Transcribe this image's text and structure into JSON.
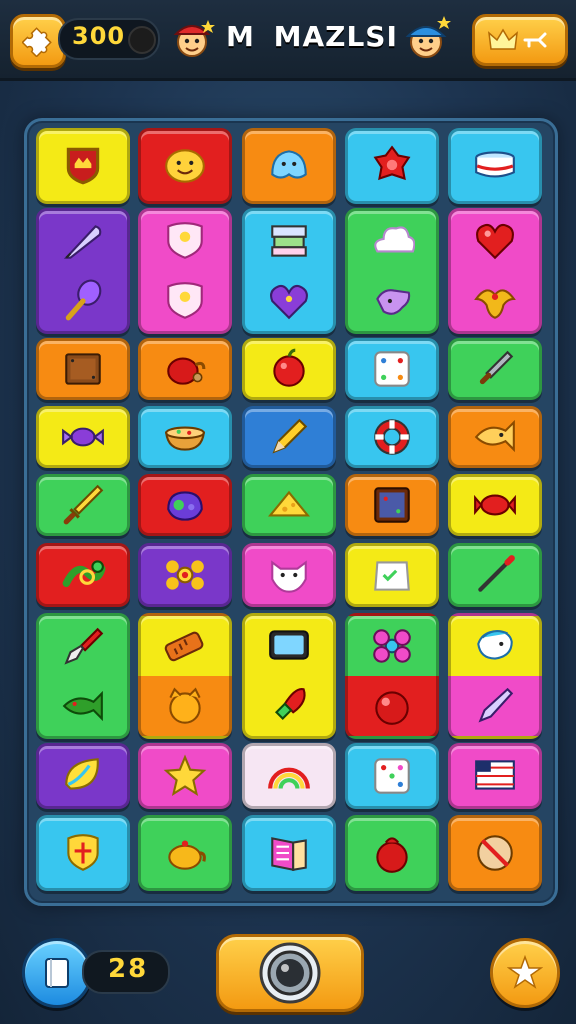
{
  "header": {
    "coins": "300",
    "title": "M MAZLSI",
    "title_prefix": "M",
    "title_main": "MAZLSI"
  },
  "footer": {
    "counter": "28"
  },
  "colors": {
    "yellow": "#f4ea16",
    "red": "#e21f1f",
    "orange": "#f78b12",
    "sky": "#38c6ef",
    "purple": "#7a37c9",
    "pink": "#f04bc8",
    "green": "#3fd15a",
    "blue": "#2f7fd6",
    "white_pink": "#f6e6f3"
  },
  "board": {
    "tiles": [
      {
        "row": 0,
        "col": 0,
        "bg": "yellow",
        "icon": "shield-crown-icon"
      },
      {
        "row": 0,
        "col": 1,
        "bg": "red",
        "icon": "smiley-blob-icon"
      },
      {
        "row": 0,
        "col": 2,
        "bg": "orange",
        "icon": "blue-slime-icon"
      },
      {
        "row": 0,
        "col": 3,
        "bg": "sky",
        "icon": "red-gem-flower-icon"
      },
      {
        "row": 0,
        "col": 4,
        "bg": "sky",
        "icon": "striped-bowl-icon"
      },
      {
        "row": 1,
        "col": 0,
        "bg": "purple",
        "icon": "feather-pen-icon",
        "icon2": "purple-torch-icon",
        "tall": true
      },
      {
        "row": 1,
        "col": 1,
        "bg": "pink",
        "icon": "pink-shield-icon",
        "icon2": "pink-shield-icon",
        "tall": true
      },
      {
        "row": 1,
        "col": 2,
        "bg": "sky",
        "icon": "stacked-boxes-icon",
        "icon2": "purple-heart-icon",
        "tall": true
      },
      {
        "row": 1,
        "col": 3,
        "bg": "green",
        "icon": "cloud-icon",
        "icon2": "purple-blob-icon",
        "tall": true
      },
      {
        "row": 1,
        "col": 4,
        "bg": "pink",
        "icon": "red-heart-icon",
        "icon2": "golden-eagle-icon",
        "tall": true
      },
      {
        "row": 2,
        "col": 0,
        "bg": "orange",
        "icon": "wooden-box-icon"
      },
      {
        "row": 2,
        "col": 1,
        "bg": "orange",
        "icon": "red-teapot-icon"
      },
      {
        "row": 2,
        "col": 2,
        "bg": "yellow",
        "icon": "apple-icon"
      },
      {
        "row": 2,
        "col": 3,
        "bg": "sky",
        "icon": "dice-icon"
      },
      {
        "row": 2,
        "col": 4,
        "bg": "green",
        "icon": "dagger-icon"
      },
      {
        "row": 3,
        "col": 0,
        "bg": "yellow",
        "icon": "candy-icon"
      },
      {
        "row": 3,
        "col": 1,
        "bg": "sky",
        "icon": "food-bowl-icon"
      },
      {
        "row": 3,
        "col": 2,
        "bg": "blue",
        "icon": "pencil-icon"
      },
      {
        "row": 3,
        "col": 3,
        "bg": "sky",
        "icon": "lifebuoy-icon"
      },
      {
        "row": 3,
        "col": 4,
        "bg": "orange",
        "icon": "fish-icon"
      },
      {
        "row": 4,
        "col": 0,
        "bg": "green",
        "icon": "sword-icon"
      },
      {
        "row": 4,
        "col": 1,
        "bg": "red",
        "icon": "purple-slime-icon"
      },
      {
        "row": 4,
        "col": 2,
        "bg": "green",
        "icon": "cheese-icon"
      },
      {
        "row": 4,
        "col": 3,
        "bg": "orange",
        "icon": "crate-icon"
      },
      {
        "row": 4,
        "col": 4,
        "bg": "yellow",
        "icon": "red-candy-icon"
      },
      {
        "row": 5,
        "col": 0,
        "bg": "red",
        "icon": "green-snake-icon"
      },
      {
        "row": 5,
        "col": 1,
        "bg": "purple",
        "icon": "bone-flower-icon"
      },
      {
        "row": 5,
        "col": 2,
        "bg": "pink",
        "icon": "ghost-cat-icon"
      },
      {
        "row": 5,
        "col": 3,
        "bg": "yellow",
        "icon": "paper-bag-icon"
      },
      {
        "row": 5,
        "col": 4,
        "bg": "green",
        "icon": "wand-icon"
      },
      {
        "row": 6,
        "col": 0,
        "bg": "green",
        "icon": "brush-icon",
        "icon2": "green-fish-icon",
        "tall": true
      },
      {
        "row": 6,
        "col": 1,
        "bg": "yellow",
        "bg2": "orange",
        "icon": "battery-icon",
        "icon2": "orange-cat-icon",
        "tall": true
      },
      {
        "row": 6,
        "col": 2,
        "bg": "yellow",
        "icon": "tv-icon",
        "icon2": "rocket-icon",
        "tall": true
      },
      {
        "row": 6,
        "col": 3,
        "bg": "green",
        "bg2": "red",
        "icon": "pink-flower-icon",
        "icon2": "red-ball-icon",
        "tall": true
      },
      {
        "row": 6,
        "col": 4,
        "bg": "yellow",
        "bg2": "pink",
        "icon": "blue-bird-icon",
        "icon2": "pen-icon",
        "tall": true
      },
      {
        "row": 7,
        "col": 0,
        "bg": "purple",
        "icon": "lemon-icon"
      },
      {
        "row": 7,
        "col": 1,
        "bg": "pink",
        "icon": "star-icon"
      },
      {
        "row": 7,
        "col": 2,
        "bg": "white_pink",
        "icon": "rainbow-icon"
      },
      {
        "row": 7,
        "col": 3,
        "bg": "sky",
        "icon": "white-dice-icon"
      },
      {
        "row": 7,
        "col": 4,
        "bg": "pink",
        "icon": "flag-icon"
      },
      {
        "row": 8,
        "col": 0,
        "bg": "sky",
        "icon": "gold-shield-icon"
      },
      {
        "row": 8,
        "col": 1,
        "bg": "green",
        "icon": "golden-teapot-icon"
      },
      {
        "row": 8,
        "col": 2,
        "bg": "sky",
        "icon": "book-icon"
      },
      {
        "row": 8,
        "col": 3,
        "bg": "green",
        "icon": "red-pot-icon"
      },
      {
        "row": 8,
        "col": 4,
        "bg": "orange",
        "icon": "forbidden-cookie-icon"
      }
    ]
  }
}
